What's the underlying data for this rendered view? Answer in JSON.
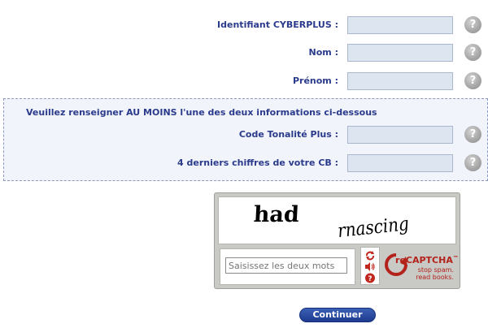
{
  "form": {
    "identifiant_label": "Identifiant CYBERPLUS :",
    "nom_label": "Nom :",
    "prenom_label": "Prénom :",
    "help_glyph": "?"
  },
  "alt_info": {
    "title": "Veuillez renseigner AU MOINS l'une des deux informations ci-dessous",
    "code_label": "Code Tonalité Plus :",
    "cb_label": "4 derniers chiffres de votre CB :"
  },
  "captcha": {
    "words": [
      "had",
      "rnascing"
    ],
    "input_placeholder": "Saisissez les deux mots",
    "refresh_icon": "refresh-icon",
    "audio_icon": "audio-icon",
    "help_icon": "help-icon",
    "logo_text": "reCAPTCHA",
    "logo_tm": "™",
    "logo_tagline_1": "stop spam.",
    "logo_tagline_2": "read books.",
    "help_glyph": "?"
  },
  "submit": {
    "label": "Continuer"
  },
  "colors": {
    "label_blue": "#2b3b8c",
    "field_bg": "#dde6f0",
    "recaptcha_red": "#b3221b",
    "button_blue": "#1e3b8e"
  }
}
